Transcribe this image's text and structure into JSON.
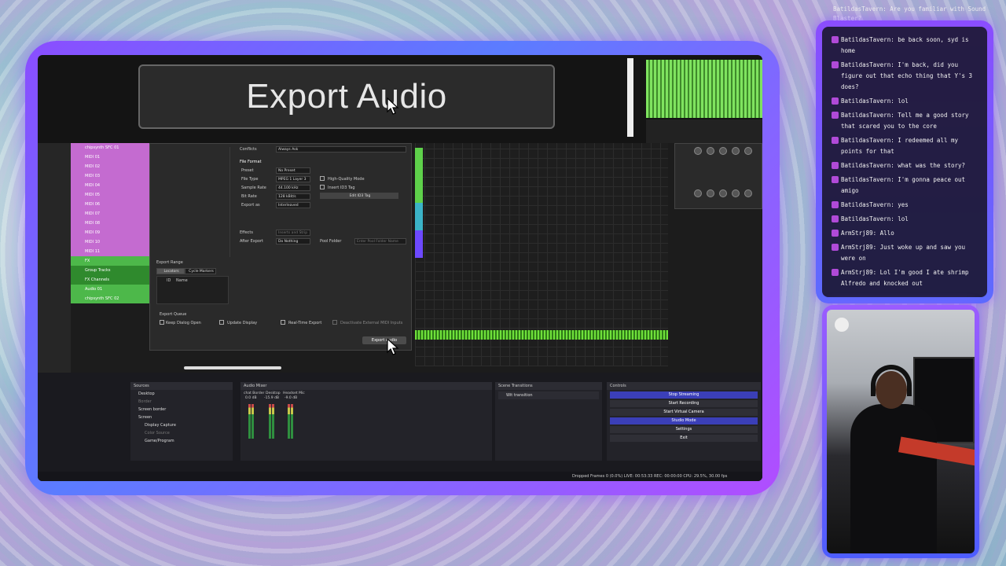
{
  "export_title": "Export Audio",
  "dialog": {
    "conflicts_label": "Conflicts",
    "conflicts_value": "Always Ask",
    "file_format_label": "File Format",
    "preset_label": "Preset",
    "preset_value": "No Preset",
    "file_type_label": "File Type",
    "file_type_value": "MPEG 1 Layer 3",
    "sample_rate_label": "Sample Rate",
    "sample_rate_value": "44.100 kHz",
    "bit_rate_label": "Bit Rate",
    "bit_rate_value": "128 kBit/s",
    "export_as_label": "Export as",
    "export_as_value": "Interleaved",
    "hq_mode": "High-Quality Mode",
    "insert_id3": "Insert ID3 Tag",
    "edit_id3": "Edit ID3 Tag",
    "effects_label": "Effects",
    "effects_value": "Inserts and Strip",
    "after_export_label": "After Export",
    "after_export_value": "Do Nothing",
    "pool_folder_label": "Pool Folder",
    "pool_folder_placeholder": "Enter Pool Folder Name",
    "export_range": "Export Range",
    "tab_locators": "Locators",
    "tab_cycle": "Cycle Markers",
    "col_id": "ID",
    "col_name": "Name",
    "export_queue": "Export Queue",
    "keep_dialog": "Keep Dialog Open",
    "update_display": "Update Display",
    "realtime_export": "Real-Time Export",
    "deactivate_midi": "Deactivate External MIDI Inputs",
    "export_button": "Export Audio"
  },
  "tracks": [
    "chipsynth SFC 01",
    "MIDI 01",
    "MIDI 02",
    "MIDI 03",
    "MIDI 04",
    "MIDI 05",
    "MIDI 06",
    "MIDI 07",
    "MIDI 08",
    "MIDI 09",
    "MIDI 10",
    "MIDI 11",
    "FX",
    "Group Tracks",
    "FX Channels",
    "Audio 01",
    "chipsynth SFC 02"
  ],
  "obs": {
    "sources_title": "Sources",
    "sources": [
      "Desktop",
      "Border",
      "Screen border",
      "Screen",
      "Display Capture",
      "Color Source",
      "Game/Program"
    ],
    "mixer_title": "Audio Mixer",
    "mixer_channels": [
      {
        "name": "chat Border",
        "level": "0.0 dB"
      },
      {
        "name": "Desktop",
        "level": "-15.9 dB"
      },
      {
        "name": "Headset Mic",
        "level": "-9.0 dB"
      }
    ],
    "transitions_title": "Scene Transitions",
    "transition_value": "Wit transition",
    "controls_title": "Controls",
    "controls": [
      "Stop Streaming",
      "Start Recording",
      "Start Virtual Camera",
      "Studio Mode",
      "Settings",
      "Exit"
    ],
    "status": "Dropped Frames 0 (0.0%)   LIVE: 00:53:33   REC: 00:00:00   CPU: 29.5%, 30.00 fps"
  },
  "chat": {
    "top_message": "BatildasTavern: Are you familiar with Sound Blaster?",
    "messages": [
      "BatildasTavern: be back soon, syd is home",
      "BatildasTavern: I'm back, did you figure out that echo thing that Y's 3 does?",
      "BatildasTavern: lol",
      "BatildasTavern: Tell me a good story that scared you to the core",
      "BatildasTavern: I redeemed all my points for that",
      "BatildasTavern: what was the story?",
      "BatildasTavern: I'm gonna peace out amigo",
      "BatildasTavern: yes",
      "BatildasTavern: lol",
      "ArmStrj89: Allo",
      "ArmStrj89: Just woke up and saw you were on",
      "ArmStrj89: Lol I'm good I ate shrimp Alfredo and knocked out"
    ]
  },
  "colors": {
    "accent": "#8b4dff",
    "frame2": "#5b7cff",
    "wave": "#6fe03a",
    "obs_active": "#3b3fb8"
  }
}
